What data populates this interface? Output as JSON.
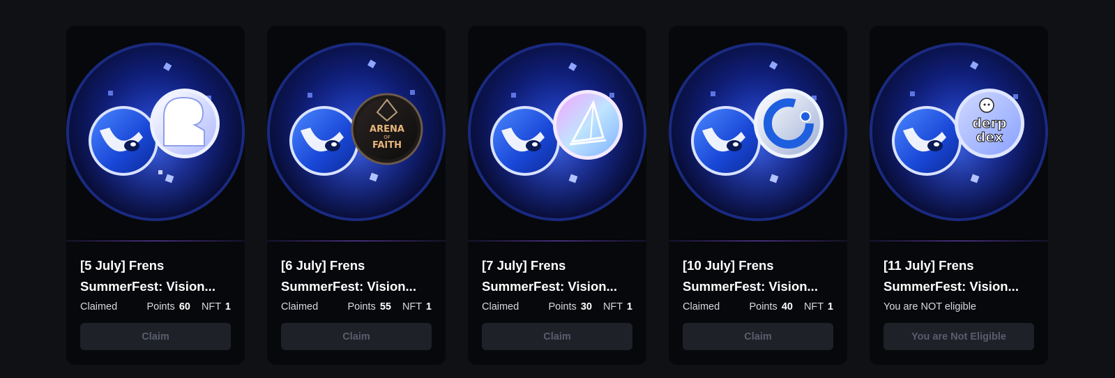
{
  "colors": {
    "page_bg": "#101115",
    "card_bg": "#07080b",
    "button_bg": "#1f2129",
    "button_text": "#5a5e6c",
    "accent_divider": "#7d4fe0",
    "orb_blue": "#1d3fd0"
  },
  "cards": [
    {
      "title_line1": "[5 July] Frens",
      "title_line2": "SummerFest: Vision...",
      "status": "Claimed",
      "points_label": "Points",
      "points_value": "60",
      "nft_label": "NFT",
      "nft_value": "1",
      "button_label": "Claim",
      "partner_icon": "white-ghost-logo-icon"
    },
    {
      "title_line1": "[6 July] Frens",
      "title_line2": "SummerFest: Vision...",
      "status": "Claimed",
      "points_label": "Points",
      "points_value": "55",
      "nft_label": "NFT",
      "nft_value": "1",
      "button_label": "Claim",
      "partner_icon": "arena-of-faith-logo-icon",
      "partner_logo_text": {
        "line1": "ARENA",
        "line2": "OF",
        "line3": "FAITH"
      }
    },
    {
      "title_line1": "[7 July] Frens",
      "title_line2": "SummerFest: Vision...",
      "status": "Claimed",
      "points_label": "Points",
      "points_value": "30",
      "nft_label": "NFT",
      "nft_value": "1",
      "button_label": "Claim",
      "partner_icon": "sailboat-logo-icon"
    },
    {
      "title_line1": "[10 July] Frens",
      "title_line2": "SummerFest: Vision...",
      "status": "Claimed",
      "points_label": "Points",
      "points_value": "40",
      "nft_label": "NFT",
      "nft_value": "1",
      "button_label": "Claim",
      "partner_icon": "ring-logo-icon"
    },
    {
      "title_line1": "[11 July] Frens",
      "title_line2": "SummerFest: Vision...",
      "status": "You are NOT eligible",
      "button_label": "You are Not Eligible",
      "partner_icon": "derp-dex-logo-icon",
      "partner_logo_text": {
        "line1": "derp",
        "line2": "dex"
      }
    }
  ]
}
